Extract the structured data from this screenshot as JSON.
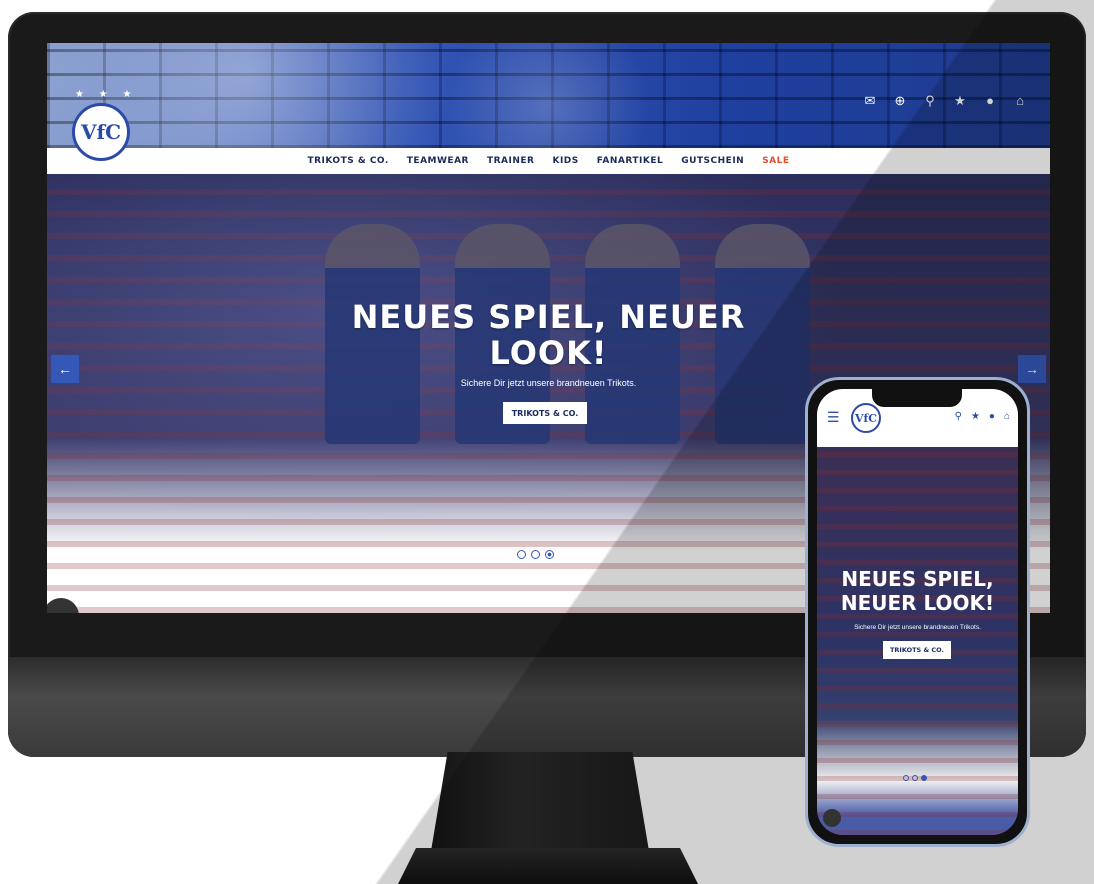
{
  "desktop": {
    "header": {
      "logo_text": "VfC",
      "stars": "★ ★ ★",
      "icons": [
        "newsletter-icon",
        "globe-icon",
        "search-icon",
        "star-icon",
        "user-icon",
        "basket-icon"
      ]
    },
    "nav": {
      "items": [
        "TRIKOTS & CO.",
        "TEAMWEAR",
        "TRAINER",
        "KIDS",
        "FANARTIKEL",
        "GUTSCHEIN",
        "SALE"
      ]
    },
    "hero": {
      "title_line1": "NEUES SPIEL, NEUER",
      "title_line2": "LOOK!",
      "subtitle": "Sichere Dir jetzt unsere brandneuen Trikots.",
      "button": "TRIKOTS & CO.",
      "prev_arrow": "←",
      "next_arrow": "→",
      "slides": 3,
      "active_slide": 3
    },
    "colors": {
      "accent": "#3557b8",
      "nav_text": "#1b2a5c",
      "sale": "#e74c2c"
    }
  },
  "mobile": {
    "header": {
      "menu_icon": "☰",
      "logo_text": "VfC",
      "icons": [
        "search-icon",
        "star-icon",
        "user-icon",
        "basket-icon"
      ]
    },
    "hero": {
      "title_line1": "NEUES SPIEL,",
      "title_line2": "NEUER LOOK!",
      "subtitle": "Sichere Dir jetzt unsere brandneuen Trikots.",
      "button": "TRIKOTS & CO.",
      "slides": 3,
      "active_slide": 3
    }
  }
}
